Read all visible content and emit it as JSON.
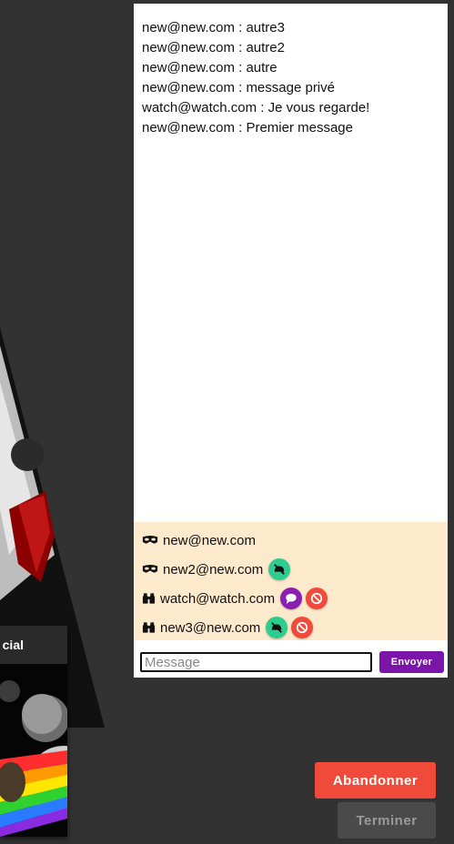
{
  "background": {
    "card_title": "cial"
  },
  "chat": {
    "messages": [
      "new@new.com : autre3",
      "new@new.com : autre2",
      "new@new.com : autre",
      "new@new.com : message privé",
      "watch@watch.com : Je vous regarde!",
      "new@new.com : Premier message"
    ],
    "users": [
      {
        "name": "new@new.com",
        "role_icon": "player-mask-icon",
        "actions": []
      },
      {
        "name": "new2@new.com",
        "role_icon": "player-mask-icon",
        "actions": [
          "unmute-icon"
        ]
      },
      {
        "name": "watch@watch.com",
        "role_icon": "binoculars-icon",
        "actions": [
          "chat-bubble-icon",
          "ban-icon"
        ]
      },
      {
        "name": "new3@new.com",
        "role_icon": "binoculars-icon",
        "actions": [
          "unmute-icon",
          "ban-icon"
        ]
      }
    ],
    "input_placeholder": "Message",
    "send_label": "Envoyer"
  },
  "footer": {
    "abandon_label": "Abandonner",
    "finish_label": "Terminer"
  },
  "colors": {
    "page_bg": "#323232",
    "users_bg": "#fde9cc",
    "purple": "#7b14a8",
    "red": "#ef4a3a",
    "green": "#2ecc8f"
  }
}
